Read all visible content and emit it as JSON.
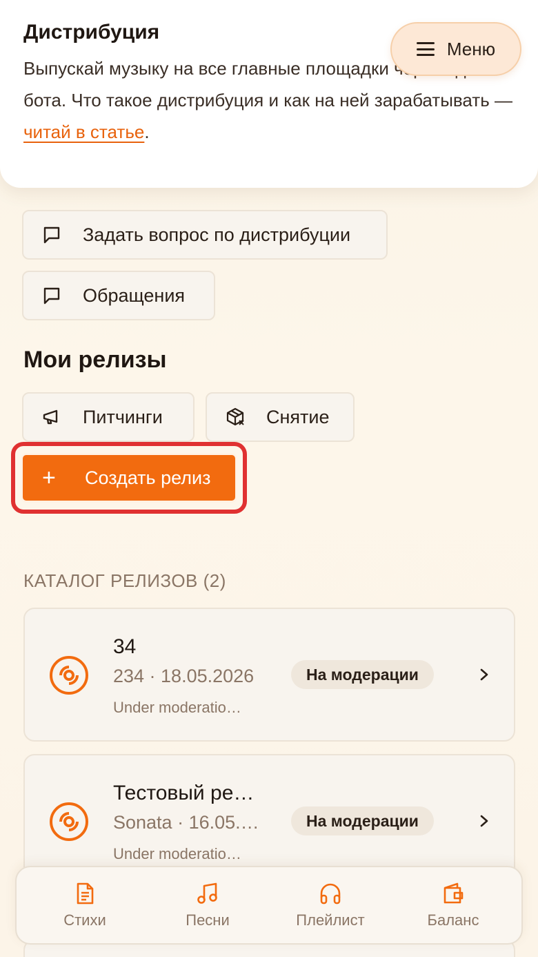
{
  "header": {
    "title": "Дистрибуция",
    "text_before_link": " Выпускай музыку на все главные площадки через одного бота. Что такое дистрибуция и как на ней зарабатывать — ",
    "link_text": "читай в статье",
    "text_after_link": ".",
    "menu_label": "Меню"
  },
  "actions": {
    "ask_question": "Задать вопрос по дистрибуции",
    "tickets": "Обращения"
  },
  "releases_section": {
    "title": "Мои релизы",
    "pitching_label": "Питчинги",
    "takedown_label": "Снятие",
    "create_label": "Создать релиз"
  },
  "catalog": {
    "label": "КАТАЛОГ РЕЛИЗОВ (2)",
    "items": [
      {
        "title": "34",
        "subtitle": "234 · 18.05.2026",
        "note": "Under moderatio…",
        "status": "На модерации"
      },
      {
        "title": "Тестовый ре…",
        "subtitle": "Sonata · 16.05.…",
        "note": "Under moderatio…",
        "status": "На модерации"
      }
    ]
  },
  "bottom_nav": {
    "items": [
      {
        "label": "Стихи",
        "icon": "document-icon"
      },
      {
        "label": "Песни",
        "icon": "music-note-icon"
      },
      {
        "label": "Плейлист",
        "icon": "headphones-icon"
      },
      {
        "label": "Баланс",
        "icon": "wallet-icon"
      }
    ]
  },
  "colors": {
    "accent": "#f26b0f",
    "highlight": "#e03131",
    "muted": "#8a7565"
  }
}
